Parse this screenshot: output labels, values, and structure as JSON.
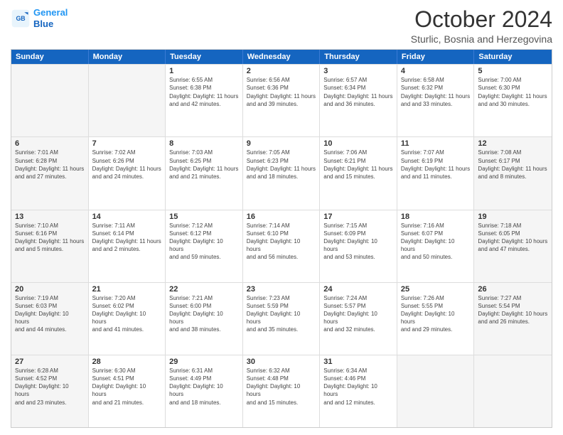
{
  "header": {
    "logo_line1": "General",
    "logo_line2": "Blue",
    "month": "October 2024",
    "location": "Sturlic, Bosnia and Herzegovina"
  },
  "days_of_week": [
    "Sunday",
    "Monday",
    "Tuesday",
    "Wednesday",
    "Thursday",
    "Friday",
    "Saturday"
  ],
  "rows": [
    [
      {
        "day": "",
        "sunrise": "",
        "sunset": "",
        "daylight": "",
        "shaded": true
      },
      {
        "day": "",
        "sunrise": "",
        "sunset": "",
        "daylight": "",
        "shaded": true
      },
      {
        "day": "1",
        "sunrise": "Sunrise: 6:55 AM",
        "sunset": "Sunset: 6:38 PM",
        "daylight": "Daylight: 11 hours and 42 minutes."
      },
      {
        "day": "2",
        "sunrise": "Sunrise: 6:56 AM",
        "sunset": "Sunset: 6:36 PM",
        "daylight": "Daylight: 11 hours and 39 minutes."
      },
      {
        "day": "3",
        "sunrise": "Sunrise: 6:57 AM",
        "sunset": "Sunset: 6:34 PM",
        "daylight": "Daylight: 11 hours and 36 minutes."
      },
      {
        "day": "4",
        "sunrise": "Sunrise: 6:58 AM",
        "sunset": "Sunset: 6:32 PM",
        "daylight": "Daylight: 11 hours and 33 minutes."
      },
      {
        "day": "5",
        "sunrise": "Sunrise: 7:00 AM",
        "sunset": "Sunset: 6:30 PM",
        "daylight": "Daylight: 11 hours and 30 minutes."
      }
    ],
    [
      {
        "day": "6",
        "sunrise": "Sunrise: 7:01 AM",
        "sunset": "Sunset: 6:28 PM",
        "daylight": "Daylight: 11 hours and 27 minutes.",
        "shaded": true
      },
      {
        "day": "7",
        "sunrise": "Sunrise: 7:02 AM",
        "sunset": "Sunset: 6:26 PM",
        "daylight": "Daylight: 11 hours and 24 minutes."
      },
      {
        "day": "8",
        "sunrise": "Sunrise: 7:03 AM",
        "sunset": "Sunset: 6:25 PM",
        "daylight": "Daylight: 11 hours and 21 minutes."
      },
      {
        "day": "9",
        "sunrise": "Sunrise: 7:05 AM",
        "sunset": "Sunset: 6:23 PM",
        "daylight": "Daylight: 11 hours and 18 minutes."
      },
      {
        "day": "10",
        "sunrise": "Sunrise: 7:06 AM",
        "sunset": "Sunset: 6:21 PM",
        "daylight": "Daylight: 11 hours and 15 minutes."
      },
      {
        "day": "11",
        "sunrise": "Sunrise: 7:07 AM",
        "sunset": "Sunset: 6:19 PM",
        "daylight": "Daylight: 11 hours and 11 minutes."
      },
      {
        "day": "12",
        "sunrise": "Sunrise: 7:08 AM",
        "sunset": "Sunset: 6:17 PM",
        "daylight": "Daylight: 11 hours and 8 minutes.",
        "shaded": true
      }
    ],
    [
      {
        "day": "13",
        "sunrise": "Sunrise: 7:10 AM",
        "sunset": "Sunset: 6:16 PM",
        "daylight": "Daylight: 11 hours and 5 minutes.",
        "shaded": true
      },
      {
        "day": "14",
        "sunrise": "Sunrise: 7:11 AM",
        "sunset": "Sunset: 6:14 PM",
        "daylight": "Daylight: 11 hours and 2 minutes."
      },
      {
        "day": "15",
        "sunrise": "Sunrise: 7:12 AM",
        "sunset": "Sunset: 6:12 PM",
        "daylight": "Daylight: 10 hours and 59 minutes."
      },
      {
        "day": "16",
        "sunrise": "Sunrise: 7:14 AM",
        "sunset": "Sunset: 6:10 PM",
        "daylight": "Daylight: 10 hours and 56 minutes."
      },
      {
        "day": "17",
        "sunrise": "Sunrise: 7:15 AM",
        "sunset": "Sunset: 6:09 PM",
        "daylight": "Daylight: 10 hours and 53 minutes."
      },
      {
        "day": "18",
        "sunrise": "Sunrise: 7:16 AM",
        "sunset": "Sunset: 6:07 PM",
        "daylight": "Daylight: 10 hours and 50 minutes."
      },
      {
        "day": "19",
        "sunrise": "Sunrise: 7:18 AM",
        "sunset": "Sunset: 6:05 PM",
        "daylight": "Daylight: 10 hours and 47 minutes.",
        "shaded": true
      }
    ],
    [
      {
        "day": "20",
        "sunrise": "Sunrise: 7:19 AM",
        "sunset": "Sunset: 6:03 PM",
        "daylight": "Daylight: 10 hours and 44 minutes.",
        "shaded": true
      },
      {
        "day": "21",
        "sunrise": "Sunrise: 7:20 AM",
        "sunset": "Sunset: 6:02 PM",
        "daylight": "Daylight: 10 hours and 41 minutes."
      },
      {
        "day": "22",
        "sunrise": "Sunrise: 7:21 AM",
        "sunset": "Sunset: 6:00 PM",
        "daylight": "Daylight: 10 hours and 38 minutes."
      },
      {
        "day": "23",
        "sunrise": "Sunrise: 7:23 AM",
        "sunset": "Sunset: 5:59 PM",
        "daylight": "Daylight: 10 hours and 35 minutes."
      },
      {
        "day": "24",
        "sunrise": "Sunrise: 7:24 AM",
        "sunset": "Sunset: 5:57 PM",
        "daylight": "Daylight: 10 hours and 32 minutes."
      },
      {
        "day": "25",
        "sunrise": "Sunrise: 7:26 AM",
        "sunset": "Sunset: 5:55 PM",
        "daylight": "Daylight: 10 hours and 29 minutes."
      },
      {
        "day": "26",
        "sunrise": "Sunrise: 7:27 AM",
        "sunset": "Sunset: 5:54 PM",
        "daylight": "Daylight: 10 hours and 26 minutes.",
        "shaded": true
      }
    ],
    [
      {
        "day": "27",
        "sunrise": "Sunrise: 6:28 AM",
        "sunset": "Sunset: 4:52 PM",
        "daylight": "Daylight: 10 hours and 23 minutes.",
        "shaded": true
      },
      {
        "day": "28",
        "sunrise": "Sunrise: 6:30 AM",
        "sunset": "Sunset: 4:51 PM",
        "daylight": "Daylight: 10 hours and 21 minutes."
      },
      {
        "day": "29",
        "sunrise": "Sunrise: 6:31 AM",
        "sunset": "Sunset: 4:49 PM",
        "daylight": "Daylight: 10 hours and 18 minutes."
      },
      {
        "day": "30",
        "sunrise": "Sunrise: 6:32 AM",
        "sunset": "Sunset: 4:48 PM",
        "daylight": "Daylight: 10 hours and 15 minutes."
      },
      {
        "day": "31",
        "sunrise": "Sunrise: 6:34 AM",
        "sunset": "Sunset: 4:46 PM",
        "daylight": "Daylight: 10 hours and 12 minutes."
      },
      {
        "day": "",
        "sunrise": "",
        "sunset": "",
        "daylight": "",
        "shaded": true
      },
      {
        "day": "",
        "sunrise": "",
        "sunset": "",
        "daylight": "",
        "shaded": true
      }
    ]
  ]
}
